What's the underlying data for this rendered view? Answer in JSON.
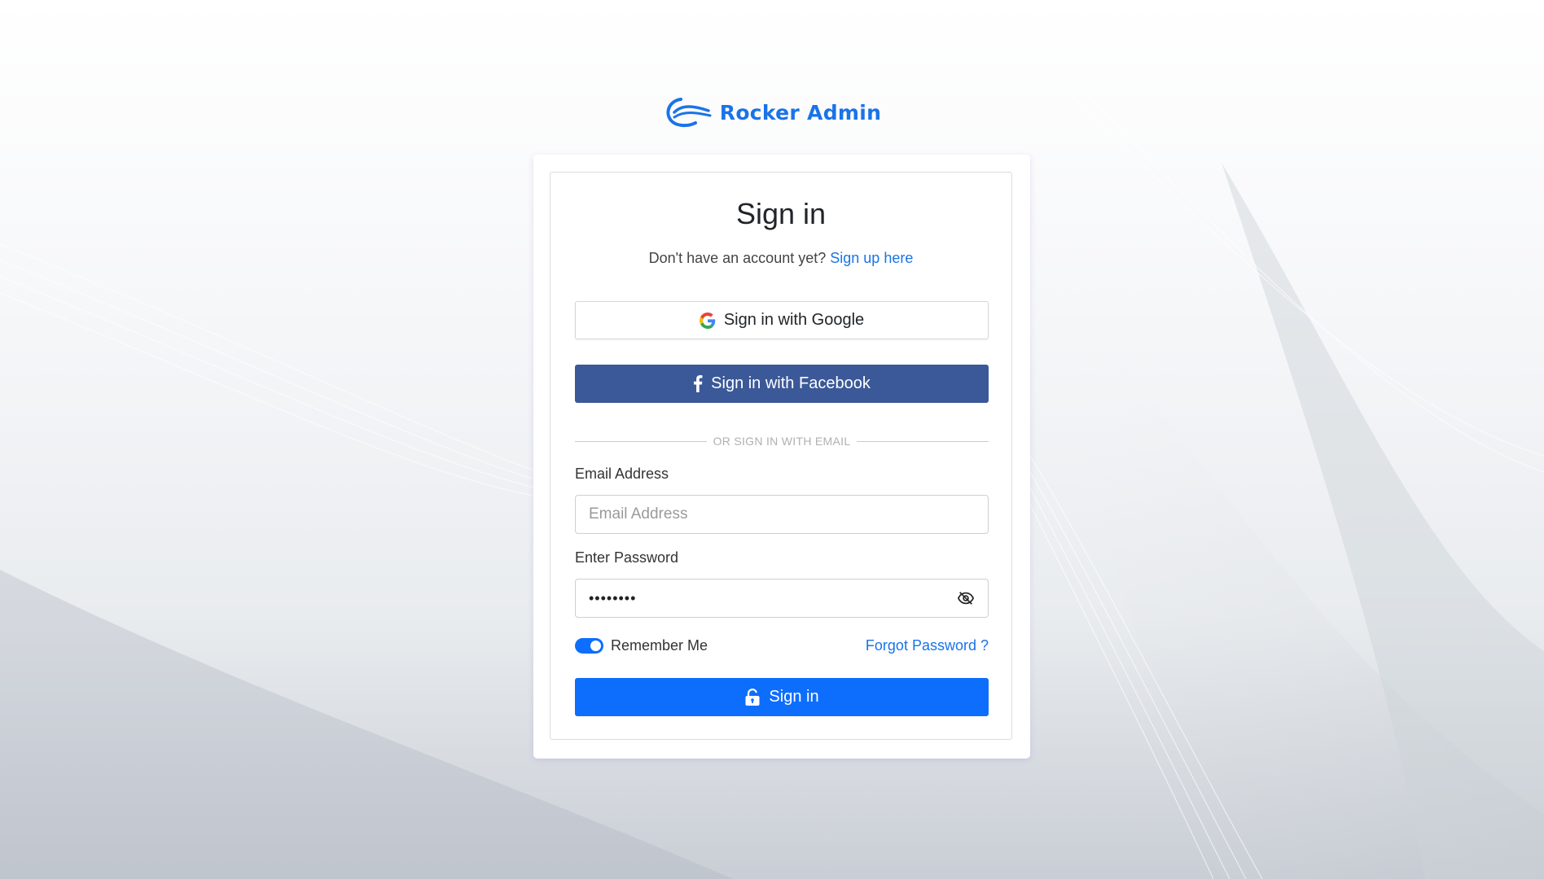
{
  "brand": {
    "name": "Rocker Admin",
    "logo_icon": "wave-logo-icon",
    "color": "#1a73e8"
  },
  "form": {
    "title": "Sign in",
    "subtitle_prefix": "Don't have an account yet?",
    "signup_link": "Sign up here",
    "google_button": {
      "label": "Sign in with Google",
      "icon": "google-icon"
    },
    "facebook_button": {
      "label": "Sign in with Facebook",
      "icon": "facebook-icon",
      "color": "#3b5998"
    },
    "divider_text": "OR SIGN IN WITH EMAIL",
    "email": {
      "label": "Email Address",
      "placeholder": "Email Address",
      "value": ""
    },
    "password": {
      "label": "Enter Password",
      "value": "••••••••",
      "toggle_icon": "eye-slash-icon"
    },
    "remember": {
      "label": "Remember Me",
      "checked": true
    },
    "forgot_link": "Forgot Password ?",
    "submit_button": {
      "label": "Sign in",
      "icon": "lock-open-icon",
      "color": "#0d6efd"
    }
  }
}
